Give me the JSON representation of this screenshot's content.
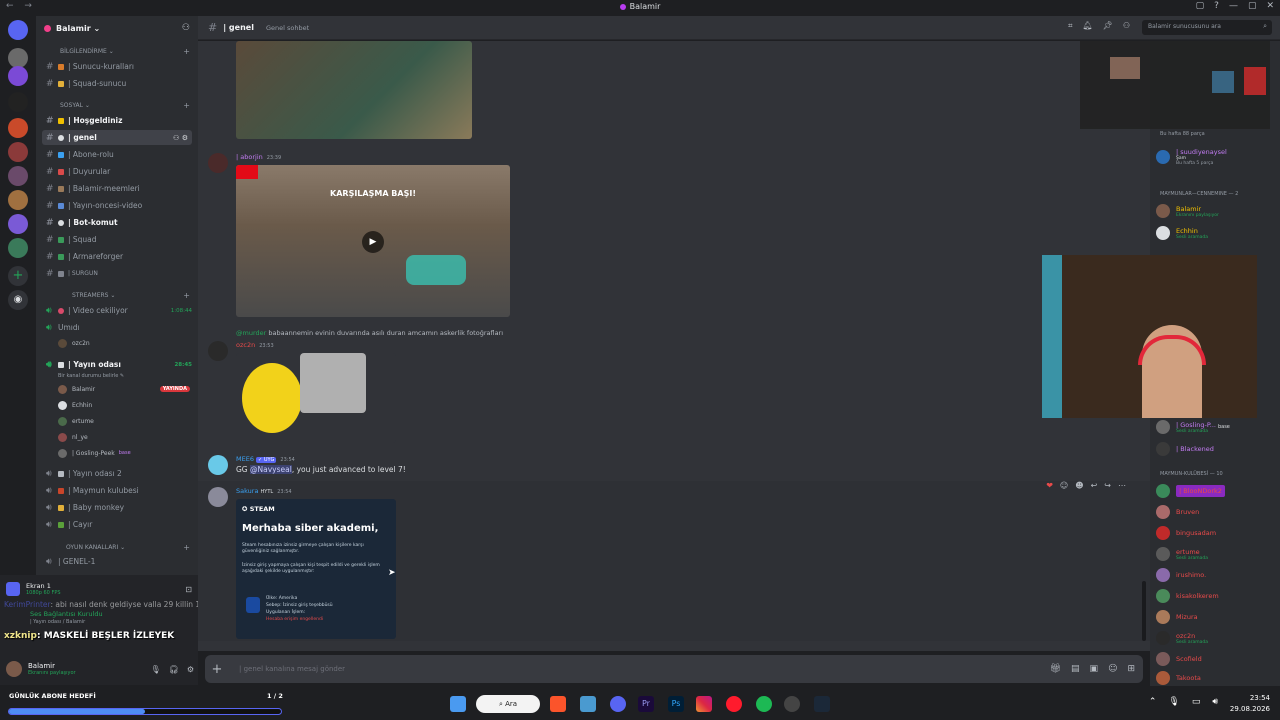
{
  "window": {
    "title": "Balamir"
  },
  "server": {
    "name": "Balamir ⌄"
  },
  "categories": [
    {
      "label": "BİLGİLENDİRME ⌄"
    },
    {
      "label": "SOSYAL ⌄"
    },
    {
      "label": "STREAMERS ⌄"
    },
    {
      "label": "OYUN KANALLARI ⌄"
    }
  ],
  "channels": [
    {
      "label": "| Sunucu-kuralları"
    },
    {
      "label": "| Squad-sunucu"
    },
    {
      "label": "| Hoşgeldiniz"
    },
    {
      "label": "| genel"
    },
    {
      "label": "| Abone-rolu"
    },
    {
      "label": "| Duyurular"
    },
    {
      "label": "| Balamir-meemleri"
    },
    {
      "label": "| Yayın-oncesi-video"
    },
    {
      "label": "| Bot-komut"
    },
    {
      "label": "| Squad"
    },
    {
      "label": "| Armareforger"
    },
    {
      "label": "| SURGUN"
    }
  ],
  "voice_channels": [
    {
      "label": "| Video cekiliyor",
      "timer": "1:08:44"
    },
    {
      "label": "Umıdı"
    },
    {
      "label": "| Yayın odası",
      "timer": "28:45",
      "status": "Bir kanal durumu belirle ✎"
    },
    {
      "label": "| Yayın odası 2"
    },
    {
      "label": "| Maymun kulubesi"
    },
    {
      "label": "| Baby monkey"
    },
    {
      "label": "| Cayır"
    },
    {
      "label": "| GENEL-1"
    }
  ],
  "voice_users": [
    {
      "name": "ozc2n"
    },
    {
      "name": "Balamir",
      "badge": "YAYINDA"
    },
    {
      "name": "Echhin"
    },
    {
      "name": "ertume"
    },
    {
      "name": "nl_ye"
    },
    {
      "name": "| Gosling-Peek",
      "tag": "base"
    }
  ],
  "user_panel": {
    "stream_title": "Ekran 1",
    "stream_sub": "1080p 60 FPS",
    "chat_line1_name": "KerimPrinter",
    "chat_line1_text": ": abi nasıl denk geldiyse valla 29 killin 1",
    "conn_status": "Ses Bağlantısı Kuruldu",
    "conn_sub": "| Yayın odası / Balamir",
    "chat_line2_name": "xzknip",
    "chat_line2_text": ": MASKELİ BEŞLER İZLEYEK",
    "me_name": "Balamir",
    "me_status": "Ekranını paylaşıyor"
  },
  "sub_goal": {
    "label": "GÜNLÜK ABONE HEDEFİ",
    "count": "1 / 2",
    "progress": 0.5
  },
  "header": {
    "channel": "| genel",
    "topic": "Genel sohbet",
    "search_placeholder": "Balamir sunucusunu ara"
  },
  "messages": [
    {
      "author": "| aborjin",
      "time": "23:39",
      "video_caption": "KARŞILAŞMA BAŞI!"
    },
    {
      "reply_to": "@murder",
      "reply_text": "babaannemin evinin duvarında asılı duran amcamın askerlik fotoğrafları",
      "author": "ozc2n",
      "time": "23:53"
    },
    {
      "author": "MEE6",
      "tag": "✓ UYG",
      "time": "23:54",
      "text_prefix": "GG",
      "mention": "@Navyseal",
      "text_suffix": ", you just advanced to level 7!"
    },
    {
      "author": "Sakura",
      "tag": "HYTL",
      "time": "23:54"
    }
  ],
  "steam_card": {
    "brand": "STEAM",
    "title": "Merhaba siber akademi,",
    "p1": "Steam hesabınıza izinsiz girmeye çalışan kişilere karşı güvenliğiniz sağlanmıştır.",
    "p2": "İzinsiz giriş yapmaya çalışan kişi tespit edildi ve gerekli işlem aşağıdaki şekilde uygulanmıştır:",
    "country_label": "Ülke:",
    "country": "Amerika",
    "reason": "Sebep: İzinsiz giriş teşebbüsü",
    "action_label": "Uygulanan İşlem:",
    "action": "Hesaba erişim engellendi"
  },
  "composer": {
    "placeholder": "| genel kanalına mesaj gönder"
  },
  "members": {
    "top_note": "Bu hafta 88 parça",
    "top_user": "| suudiyenaysel",
    "top_user_sub": "Şam",
    "top_user_note": "Bu hafta 5 parça",
    "cat1": "MAYMUNLAR—CENNEMINE — 2",
    "list1": [
      {
        "name": "Balamir",
        "status": "Ekranını paylaşıyor",
        "color": "#f0c000"
      },
      {
        "name": "Echhin",
        "status": "Sesli aramada",
        "color": "#f0c000"
      }
    ],
    "list2": [
      {
        "name": "| Gosling-P...",
        "status": "Sesli aramada",
        "color": "#c27cf2",
        "tag": "base"
      },
      {
        "name": "| Blackened",
        "status": "",
        "color": "#c27cf2"
      }
    ],
    "cat2": "MAYMUN-KULÜBESİ — 10",
    "list3": [
      {
        "name": "| BlooNDork2",
        "status": "",
        "color": "#e84a4a"
      },
      {
        "name": "Bruven",
        "status": "",
        "color": "#e84a4a"
      },
      {
        "name": "bingusadam",
        "status": "",
        "color": "#e84a4a"
      },
      {
        "name": "ertume",
        "status": "Sesli aramada",
        "color": "#e84a4a"
      },
      {
        "name": "irushimo.",
        "status": "",
        "color": "#e84a4a"
      },
      {
        "name": "kisakolkerem",
        "status": "",
        "color": "#e84a4a"
      },
      {
        "name": "Mizura",
        "status": "",
        "color": "#e84a4a"
      },
      {
        "name": "ozc2n",
        "status": "Sesli aramada",
        "color": "#e84a4a"
      },
      {
        "name": "Scofield",
        "status": "",
        "color": "#e84a4a"
      },
      {
        "name": "Takoota",
        "status": "",
        "color": "#e84a4a"
      }
    ]
  },
  "taskbar": {
    "search": "Ara",
    "time": "23:54",
    "date": "29.08.2026"
  }
}
